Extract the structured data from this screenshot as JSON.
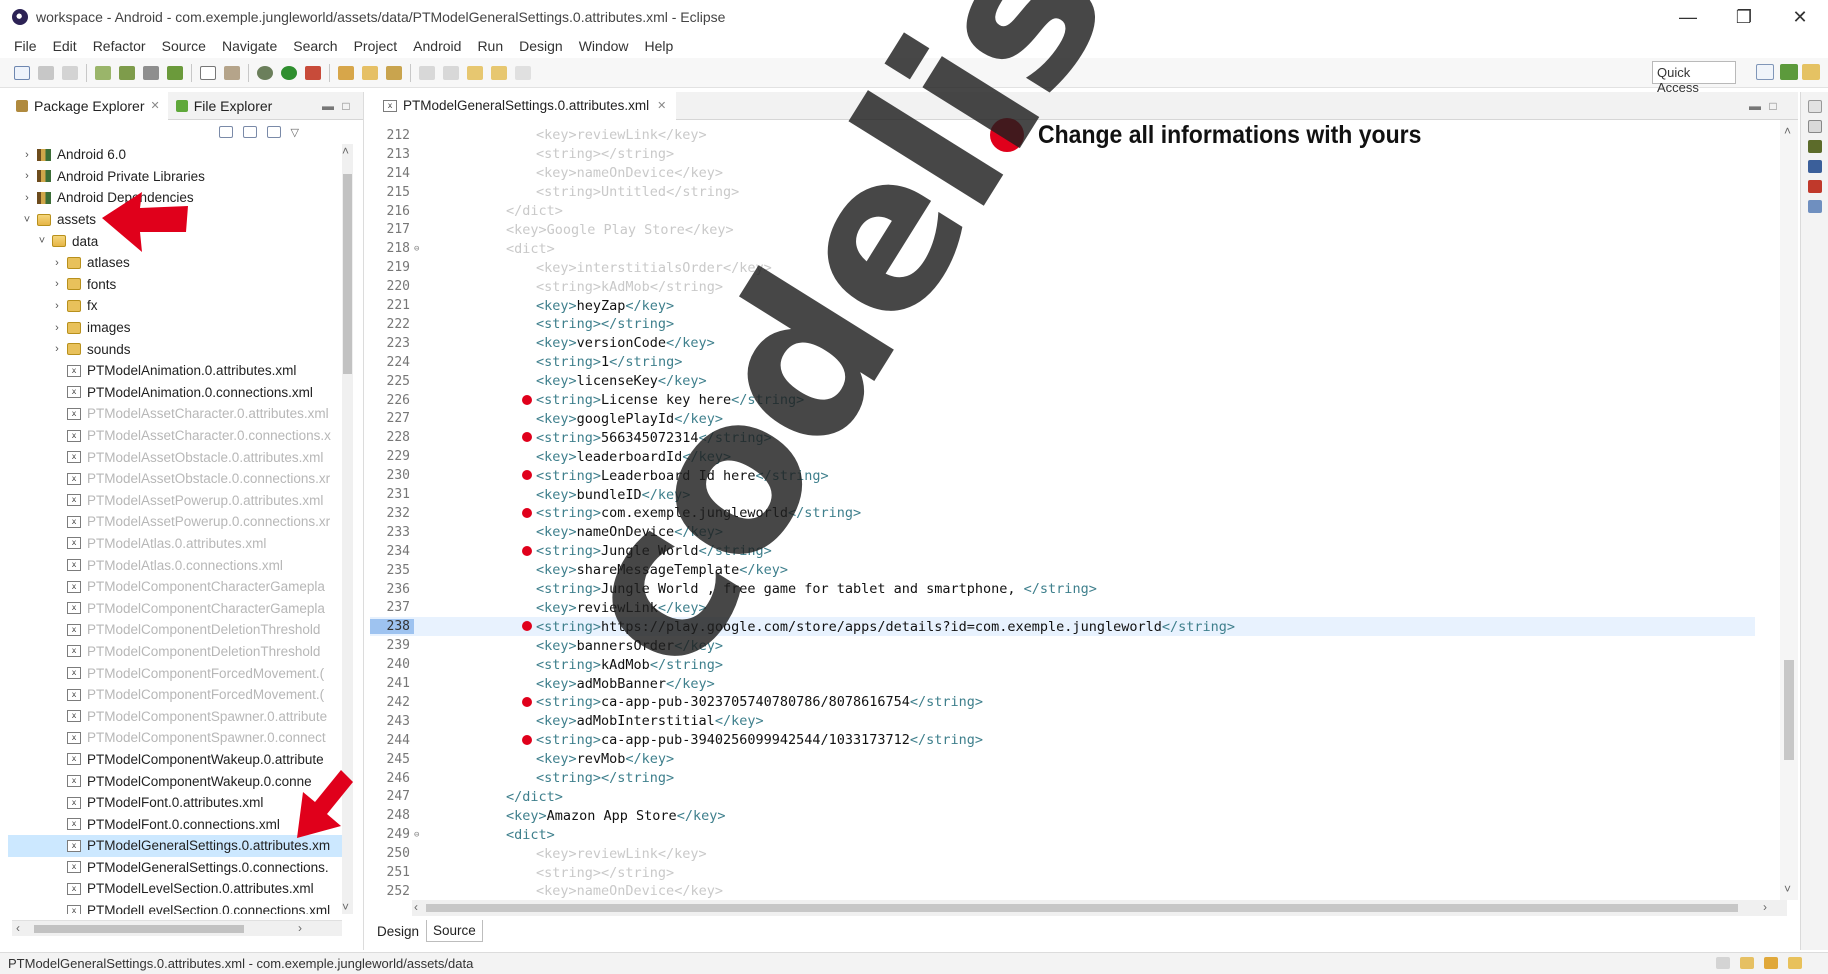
{
  "window": {
    "title": "workspace - Android - com.exemple.jungleworld/assets/data/PTModelGeneralSettings.0.attributes.xml - Eclipse"
  },
  "menu": [
    "File",
    "Edit",
    "Refactor",
    "Source",
    "Navigate",
    "Search",
    "Project",
    "Android",
    "Run",
    "Design",
    "Window",
    "Help"
  ],
  "toolbar": {
    "quick_access": "Quick Access"
  },
  "left_panel": {
    "tabs": [
      {
        "label": "Package Explorer",
        "icon": "package-explorer-icon",
        "active": true
      },
      {
        "label": "File Explorer",
        "icon": "file-explorer-icon",
        "active": false
      }
    ],
    "tree": [
      {
        "label": "Android 6.0",
        "indent": 0,
        "twisty": "›",
        "icon": "lib",
        "faded": false
      },
      {
        "label": "Android Private Libraries",
        "indent": 0,
        "twisty": "›",
        "icon": "lib",
        "faded": false
      },
      {
        "label": "Android Dependencies",
        "indent": 0,
        "twisty": "›",
        "icon": "lib",
        "faded": false
      },
      {
        "label": "assets",
        "indent": 0,
        "twisty": "˅",
        "icon": "folder-open",
        "faded": false
      },
      {
        "label": "data",
        "indent": 1,
        "twisty": "˅",
        "icon": "folder-open",
        "faded": false
      },
      {
        "label": "atlases",
        "indent": 2,
        "twisty": "›",
        "icon": "folder",
        "faded": false
      },
      {
        "label": "fonts",
        "indent": 2,
        "twisty": "›",
        "icon": "folder",
        "faded": false
      },
      {
        "label": "fx",
        "indent": 2,
        "twisty": "›",
        "icon": "folder",
        "faded": false
      },
      {
        "label": "images",
        "indent": 2,
        "twisty": "›",
        "icon": "folder",
        "faded": false
      },
      {
        "label": "sounds",
        "indent": 2,
        "twisty": "›",
        "icon": "folder",
        "faded": false
      },
      {
        "label": "PTModelAnimation.0.attributes.xml",
        "indent": 2,
        "twisty": "",
        "icon": "xml",
        "faded": false
      },
      {
        "label": "PTModelAnimation.0.connections.xml",
        "indent": 2,
        "twisty": "",
        "icon": "xml",
        "faded": false
      },
      {
        "label": "PTModelAssetCharacter.0.attributes.xml",
        "indent": 2,
        "twisty": "",
        "icon": "xml",
        "faded": true
      },
      {
        "label": "PTModelAssetCharacter.0.connections.x",
        "indent": 2,
        "twisty": "",
        "icon": "xml",
        "faded": true
      },
      {
        "label": "PTModelAssetObstacle.0.attributes.xml",
        "indent": 2,
        "twisty": "",
        "icon": "xml",
        "faded": true
      },
      {
        "label": "PTModelAssetObstacle.0.connections.xr",
        "indent": 2,
        "twisty": "",
        "icon": "xml",
        "faded": true
      },
      {
        "label": "PTModelAssetPowerup.0.attributes.xml",
        "indent": 2,
        "twisty": "",
        "icon": "xml",
        "faded": true
      },
      {
        "label": "PTModelAssetPowerup.0.connections.xr",
        "indent": 2,
        "twisty": "",
        "icon": "xml",
        "faded": true
      },
      {
        "label": "PTModelAtlas.0.attributes.xml",
        "indent": 2,
        "twisty": "",
        "icon": "xml",
        "faded": true
      },
      {
        "label": "PTModelAtlas.0.connections.xml",
        "indent": 2,
        "twisty": "",
        "icon": "xml",
        "faded": true
      },
      {
        "label": "PTModelComponentCharacterGamepla",
        "indent": 2,
        "twisty": "",
        "icon": "xml",
        "faded": true
      },
      {
        "label": "PTModelComponentCharacterGamepla",
        "indent": 2,
        "twisty": "",
        "icon": "xml",
        "faded": true
      },
      {
        "label": "PTModelComponentDeletionThreshold",
        "indent": 2,
        "twisty": "",
        "icon": "xml",
        "faded": true
      },
      {
        "label": "PTModelComponentDeletionThreshold",
        "indent": 2,
        "twisty": "",
        "icon": "xml",
        "faded": true
      },
      {
        "label": "PTModelComponentForcedMovement.(",
        "indent": 2,
        "twisty": "",
        "icon": "xml",
        "faded": true
      },
      {
        "label": "PTModelComponentForcedMovement.(",
        "indent": 2,
        "twisty": "",
        "icon": "xml",
        "faded": true
      },
      {
        "label": "PTModelComponentSpawner.0.attribute",
        "indent": 2,
        "twisty": "",
        "icon": "xml",
        "faded": true
      },
      {
        "label": "PTModelComponentSpawner.0.connect",
        "indent": 2,
        "twisty": "",
        "icon": "xml",
        "faded": true
      },
      {
        "label": "PTModelComponentWakeup.0.attribute",
        "indent": 2,
        "twisty": "",
        "icon": "xml",
        "faded": false
      },
      {
        "label": "PTModelComponentWakeup.0.conne",
        "indent": 2,
        "twisty": "",
        "icon": "xml",
        "faded": false
      },
      {
        "label": "PTModelFont.0.attributes.xml",
        "indent": 2,
        "twisty": "",
        "icon": "xml",
        "faded": false
      },
      {
        "label": "PTModelFont.0.connections.xml",
        "indent": 2,
        "twisty": "",
        "icon": "xml",
        "faded": false
      },
      {
        "label": "PTModelGeneralSettings.0.attributes.xm",
        "indent": 2,
        "twisty": "",
        "icon": "xml",
        "faded": false,
        "selected": true
      },
      {
        "label": "PTModelGeneralSettings.0.connections.",
        "indent": 2,
        "twisty": "",
        "icon": "xml",
        "faded": false
      },
      {
        "label": "PTModelLevelSection.0.attributes.xml",
        "indent": 2,
        "twisty": "",
        "icon": "xml",
        "faded": false
      },
      {
        "label": "PTModelLevelSection.0.connections.xml",
        "indent": 2,
        "twisty": "",
        "icon": "xml",
        "faded": false
      }
    ]
  },
  "editor": {
    "tab_label": "PTModelGeneralSettings.0.attributes.xml",
    "lines": [
      {
        "n": "212",
        "indent": 6,
        "code": "<key>reviewLink</key>",
        "faded": true
      },
      {
        "n": "213",
        "indent": 6,
        "code": "<string></string>",
        "faded": true
      },
      {
        "n": "214",
        "indent": 6,
        "code": "<key>nameOnDevice</key>",
        "faded": true
      },
      {
        "n": "215",
        "indent": 6,
        "code": "<string>Untitled</string>",
        "faded": true
      },
      {
        "n": "216",
        "indent": 4,
        "code": "</dict>",
        "faded": true
      },
      {
        "n": "217",
        "indent": 4,
        "code": "<key>Google Play Store</key>",
        "faded": true
      },
      {
        "n": "218",
        "indent": 4,
        "code": "<dict>",
        "faded": true,
        "fold": true
      },
      {
        "n": "219",
        "indent": 6,
        "code": "<key>interstitialsOrder</key>",
        "faded": true
      },
      {
        "n": "220",
        "indent": 6,
        "code": "<string>kAdMob</string>",
        "faded": true
      },
      {
        "n": "221",
        "indent": 6,
        "code": "<key>heyZap</key>",
        "faded": false
      },
      {
        "n": "222",
        "indent": 6,
        "code": "<string></string>",
        "faded": false
      },
      {
        "n": "223",
        "indent": 6,
        "code": "<key>versionCode</key>",
        "faded": false
      },
      {
        "n": "224",
        "indent": 6,
        "code": "<string>1</string>",
        "faded": false
      },
      {
        "n": "225",
        "indent": 6,
        "code": "<key>licenseKey</key>",
        "faded": false
      },
      {
        "n": "226",
        "indent": 6,
        "code": "<string>License key here</string>",
        "faded": false,
        "dot": true
      },
      {
        "n": "227",
        "indent": 6,
        "code": "<key>googlePlayId</key>",
        "faded": false
      },
      {
        "n": "228",
        "indent": 6,
        "code": "<string>566345072314</string>",
        "faded": false,
        "dot": true
      },
      {
        "n": "229",
        "indent": 6,
        "code": "<key>leaderboardId</key>",
        "faded": false
      },
      {
        "n": "230",
        "indent": 6,
        "code": "<string>Leaderboard Id here</string>",
        "faded": false,
        "dot": true
      },
      {
        "n": "231",
        "indent": 6,
        "code": "<key>bundleID</key>",
        "faded": false
      },
      {
        "n": "232",
        "indent": 6,
        "code": "<string>com.exemple.jungleworld</string>",
        "faded": false,
        "dot": true
      },
      {
        "n": "233",
        "indent": 6,
        "code": "<key>nameOnDevice</key>",
        "faded": false
      },
      {
        "n": "234",
        "indent": 6,
        "code": "<string>Jungle World</string>",
        "faded": false,
        "dot": true
      },
      {
        "n": "235",
        "indent": 6,
        "code": "<key>shareMessageTemplate</key>",
        "faded": false
      },
      {
        "n": "236",
        "indent": 6,
        "code": "<string>Jungle World , free game for tablet and smartphone, </string>",
        "faded": false
      },
      {
        "n": "237",
        "indent": 6,
        "code": "<key>reviewLink</key>",
        "faded": false
      },
      {
        "n": "238",
        "indent": 6,
        "code": "<string>https://play.google.com/store/apps/details?id=com.exemple.jungleworld</string>",
        "faded": false,
        "dot": true,
        "current": true
      },
      {
        "n": "239",
        "indent": 6,
        "code": "<key>bannersOrder</key>",
        "faded": false
      },
      {
        "n": "240",
        "indent": 6,
        "code": "<string>kAdMob</string>",
        "faded": false
      },
      {
        "n": "241",
        "indent": 6,
        "code": "<key>adMobBanner</key>",
        "faded": false
      },
      {
        "n": "242",
        "indent": 6,
        "code": "<string>ca-app-pub-3023705740780786/8078616754</string>",
        "faded": false,
        "dot": true
      },
      {
        "n": "243",
        "indent": 6,
        "code": "<key>adMobInterstitial</key>",
        "faded": false
      },
      {
        "n": "244",
        "indent": 6,
        "code": "<string>ca-app-pub-3940256099942544/1033173712</string>",
        "faded": false,
        "dot": true
      },
      {
        "n": "245",
        "indent": 6,
        "code": "<key>revMob</key>",
        "faded": false
      },
      {
        "n": "246",
        "indent": 6,
        "code": "<string></string>",
        "faded": false
      },
      {
        "n": "247",
        "indent": 4,
        "code": "</dict>",
        "faded": false
      },
      {
        "n": "248",
        "indent": 4,
        "code": "<key>Amazon App Store</key>",
        "faded": false
      },
      {
        "n": "249",
        "indent": 4,
        "code": "<dict>",
        "faded": false,
        "fold": true
      },
      {
        "n": "250",
        "indent": 6,
        "code": "<key>reviewLink</key>",
        "faded": true
      },
      {
        "n": "251",
        "indent": 6,
        "code": "<string></string>",
        "faded": true
      },
      {
        "n": "252",
        "indent": 6,
        "code": "<key>nameOnDevice</key>",
        "faded": true
      }
    ],
    "bottom_tabs": [
      {
        "label": "Design",
        "active": false
      },
      {
        "label": "Source",
        "active": true
      }
    ]
  },
  "annotation": {
    "text": "Change all informations with yours"
  },
  "watermark": "codelist.cc",
  "status": {
    "text": "PTModelGeneralSettings.0.attributes.xml - com.exemple.jungleworld/assets/data"
  },
  "colors": {
    "accent_red": "#e0001b",
    "selection_blue": "#cce8ff",
    "xml_tag": "#3e7f8c"
  }
}
